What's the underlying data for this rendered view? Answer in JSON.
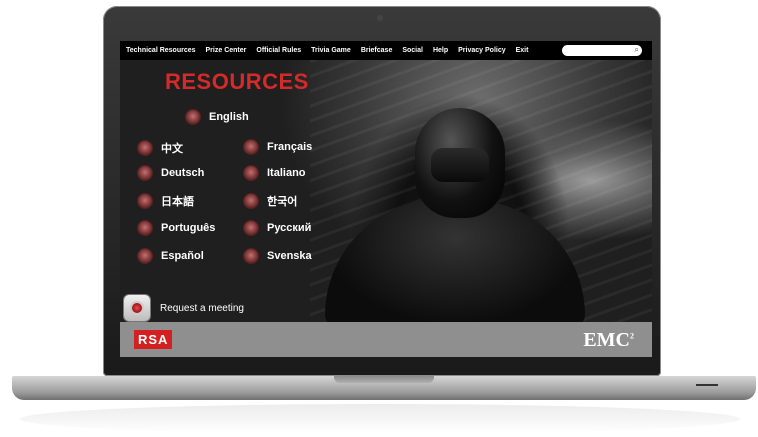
{
  "nav": {
    "items": [
      "Technical Resources",
      "Prize Center",
      "Official Rules",
      "Trivia Game",
      "Briefcase",
      "Social",
      "Help",
      "Privacy Policy",
      "Exit"
    ],
    "search_placeholder": ""
  },
  "hero": {
    "title": "RESOURCES"
  },
  "languages": {
    "english": "English",
    "chinese": "中文",
    "french": "Français",
    "german": "Deutsch",
    "italian": "Italiano",
    "japanese": "日本語",
    "korean": "한국어",
    "portuguese": "Português",
    "russian": "Русский",
    "spanish": "Español",
    "swedish": "Svenska"
  },
  "request": {
    "label": "Request a meeting"
  },
  "footer": {
    "rsa": "RSA",
    "emc": "EMC",
    "emc_sup": "2"
  },
  "colors": {
    "title_red": "#d42a2a",
    "rsa_red": "#d42020",
    "footer_gray": "#8f8f8f"
  },
  "icons": {
    "search": "magnifier",
    "language": "red-orb",
    "request": "record-button"
  }
}
